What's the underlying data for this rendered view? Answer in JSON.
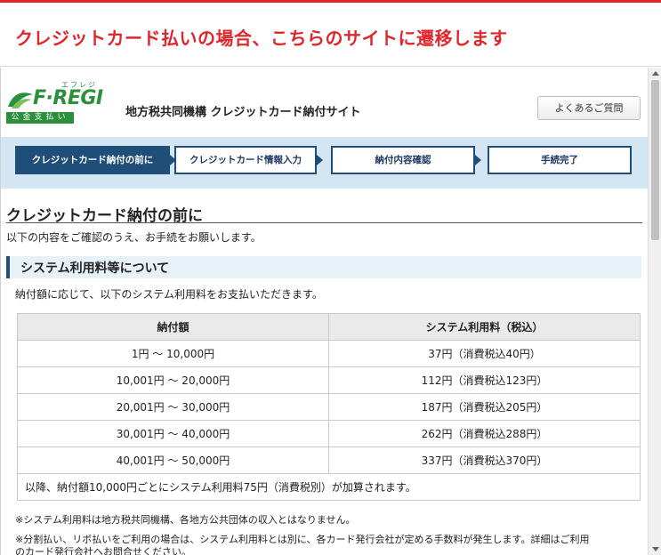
{
  "banner": {
    "text": "クレジットカード払いの場合、こちらのサイトに遷移します",
    "color": "#e0262c"
  },
  "header": {
    "logo_text": "F·REGI",
    "logo_ruby": "エフレジ",
    "logo_sub": "公金支払い",
    "site_title": "地方税共同機構 クレジットカード納付サイト",
    "faq_label": "よくあるご質問",
    "brand_color": "#2b8f3c"
  },
  "steps": [
    {
      "label": "クレジットカード納付の前に",
      "active": true
    },
    {
      "label": "クレジットカード情報入力",
      "active": false
    },
    {
      "label": "納付内容確認",
      "active": false
    },
    {
      "label": "手続完了",
      "active": false
    }
  ],
  "main": {
    "title": "クレジットカード納付の前に",
    "description": "以下の内容をご確認のうえ、お手続をお願いします。",
    "fees_heading": "システム利用料等について",
    "fees_description": "納付額に応じて、以下のシステム利用料をお支払いただきます。"
  },
  "fee_table": {
    "headers": [
      "納付額",
      "システム利用料（税込）"
    ],
    "rows": [
      [
        "1円 ～ 10,000円",
        "37円（消費税込40円）"
      ],
      [
        "10,001円 ～ 20,000円",
        "112円（消費税込123円）"
      ],
      [
        "20,001円 ～ 30,000円",
        "187円（消費税込205円）"
      ],
      [
        "30,001円 ～ 40,000円",
        "262円（消費税込288円）"
      ],
      [
        "40,001円 ～ 50,000円",
        "337円（消費税込370円）"
      ]
    ],
    "note": "以降、納付額10,000円ごとにシステム利用料75円（消費税別）が加算されます。"
  },
  "footnotes": [
    "※システム利用料は地方税共同機構、各地方公共団体の収入とはなりません。",
    "※分割払い、リボ払いをご利用の場合は、システム利用料とは別に、各カード発行会社が定める手数料が発生します。詳細はご利用",
    "のカード発行会社へお問合せください。"
  ],
  "colors": {
    "accent": "#1f4e79",
    "step_bar_bg": "#d4e6f3"
  }
}
